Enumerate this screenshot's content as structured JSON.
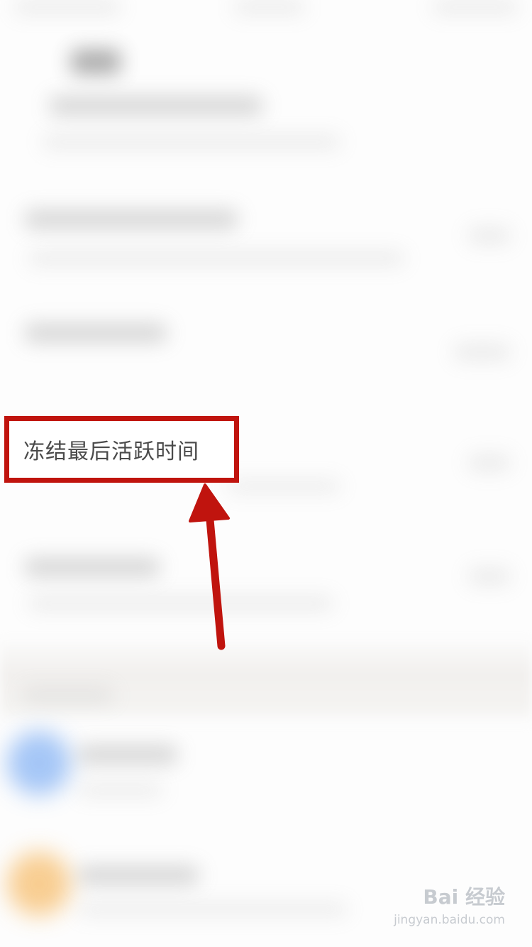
{
  "callout": {
    "label": "冻结最后活跃时间",
    "accent_color": "#c0140e"
  },
  "watermark": {
    "logo_text": "Bai 经验",
    "url": "jingyan.baidu.com"
  }
}
